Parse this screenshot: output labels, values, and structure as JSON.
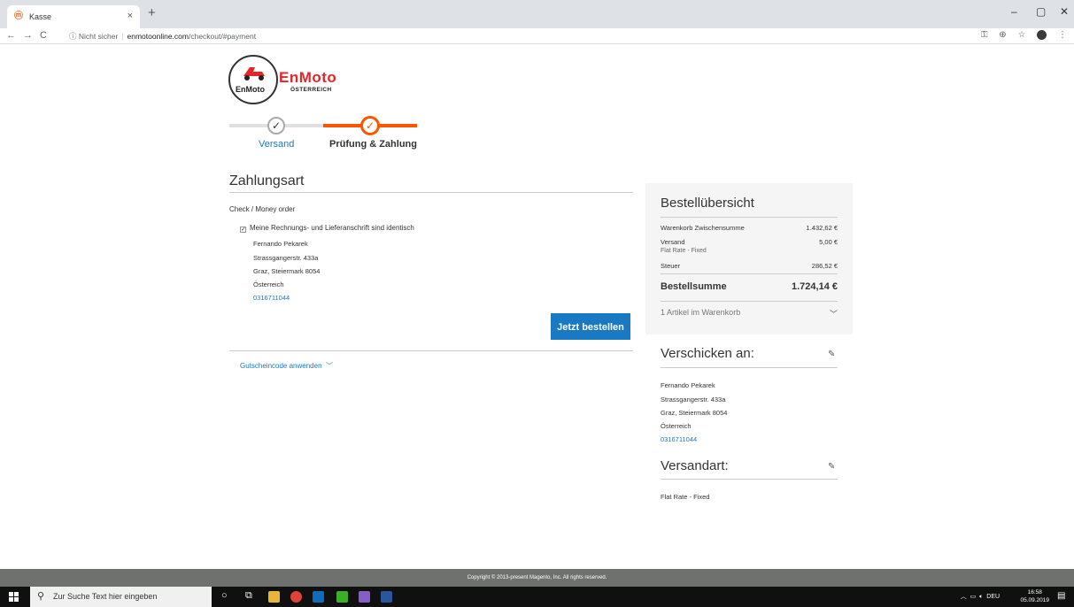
{
  "browser": {
    "tab_title": "Kasse",
    "tab_close": "×",
    "new_tab": "+",
    "security_label": "Nicht sicher",
    "url_host": "enmotoonline.com",
    "url_path": "/checkout/#payment",
    "window_controls": [
      "–",
      "▢",
      "✕"
    ]
  },
  "logo": {
    "circle_text": "EnMoto",
    "brand": "EnMoto",
    "sub": "ÖSTERREICH"
  },
  "progress": {
    "step1_label": "Versand",
    "step2_label": "Prüfung & Zahlung",
    "check": "✓"
  },
  "payment": {
    "title": "Zahlungsart",
    "method": "Check / Money order",
    "same_address_label": "Meine Rechnungs- und Lieferanschrift sind identisch",
    "address": {
      "name": "Fernando Pekarek",
      "street": "Strassgangerstr. 433a",
      "city": "Graz, Steiermark 8054",
      "country": "Österreich",
      "phone": "0316711044"
    },
    "order_button": "Jetzt bestellen",
    "coupon_label": "Gutscheincode anwenden"
  },
  "summary": {
    "title": "Bestellübersicht",
    "subtotal_label": "Warenkorb Zwischensumme",
    "subtotal_value": "1.432,62 €",
    "shipping_label": "Versand",
    "shipping_method": "Flat Rate - Fixed",
    "shipping_value": "5,00 €",
    "tax_label": "Steuer",
    "tax_value": "286,52 €",
    "total_label": "Bestellsumme",
    "total_value": "1.724,14 €",
    "cart_count": "1 Artikel im Warenkorb"
  },
  "ship_to": {
    "title": "Verschicken an:",
    "name": "Fernando Pekarek",
    "street": "Strassgangerstr. 433a",
    "city": "Graz, Steiermark 8054",
    "country": "Österreich",
    "phone": "0316711044"
  },
  "ship_method": {
    "title": "Versandart:",
    "value": "Flat Rate - Fixed"
  },
  "footer": {
    "copyright": "Copyright © 2013-present Magento, Inc. All rights reserved."
  },
  "taskbar": {
    "search_placeholder": "Zur Suche Text hier eingeben",
    "language": "DEU",
    "time": "16:58",
    "date": "05.09.2019"
  }
}
